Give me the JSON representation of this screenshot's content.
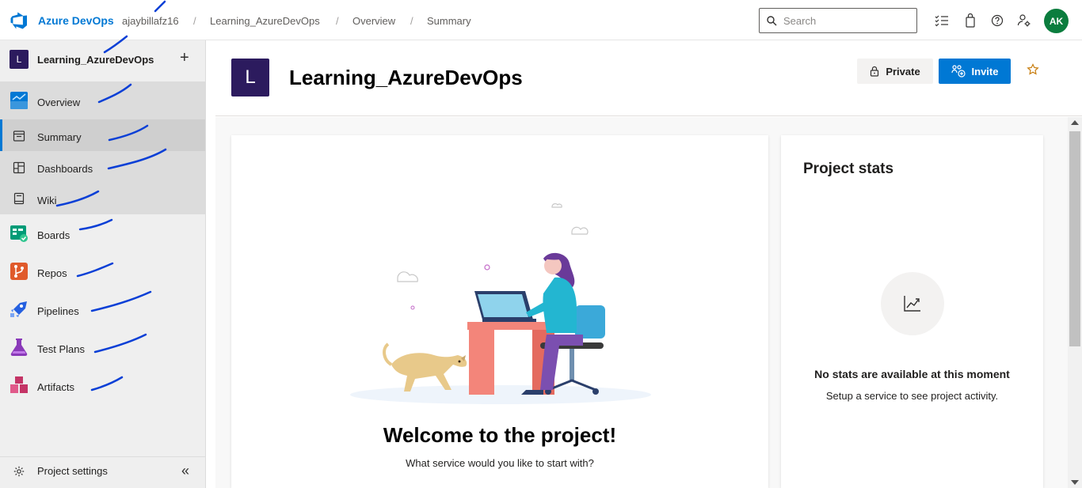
{
  "topbar": {
    "brand": "Azure DevOps",
    "breadcrumbs": [
      "ajaybillafz16",
      "Learning_AzureDevOps",
      "Overview",
      "Summary"
    ],
    "separator": "/",
    "search_placeholder": "Search",
    "avatar_initials": "AK",
    "icons": [
      "task-list-icon",
      "shopping-bag-icon",
      "help-icon",
      "user-settings-icon"
    ]
  },
  "sidebar": {
    "project_initial": "L",
    "project_name": "Learning_AzureDevOps",
    "add_symbol": "+",
    "items": [
      {
        "label": "Overview",
        "icon": "overview-icon"
      },
      {
        "label": "Summary",
        "icon": "summary-icon",
        "selected": true
      },
      {
        "label": "Dashboards",
        "icon": "dashboards-icon"
      },
      {
        "label": "Wiki",
        "icon": "wiki-icon"
      },
      {
        "label": "Boards",
        "icon": "boards-icon"
      },
      {
        "label": "Repos",
        "icon": "repos-icon"
      },
      {
        "label": "Pipelines",
        "icon": "pipelines-icon"
      },
      {
        "label": "Test Plans",
        "icon": "test-plans-icon"
      },
      {
        "label": "Artifacts",
        "icon": "artifacts-icon"
      }
    ],
    "settings_label": "Project settings",
    "collapse_symbol": "«"
  },
  "header": {
    "project_initial": "L",
    "title": "Learning_AzureDevOps",
    "private_label": "Private",
    "invite_label": "Invite"
  },
  "welcome": {
    "title": "Welcome to the project!",
    "subtitle": "What service would you like to start with?"
  },
  "stats": {
    "title": "Project stats",
    "empty_title": "No stats are available at this moment",
    "empty_subtitle": "Setup a service to see project activity."
  },
  "colors": {
    "accent": "#0078d4",
    "project_badge": "#2c1b5e",
    "avatar": "#0b7d3e",
    "annotation_ink": "#0a3fd6"
  }
}
